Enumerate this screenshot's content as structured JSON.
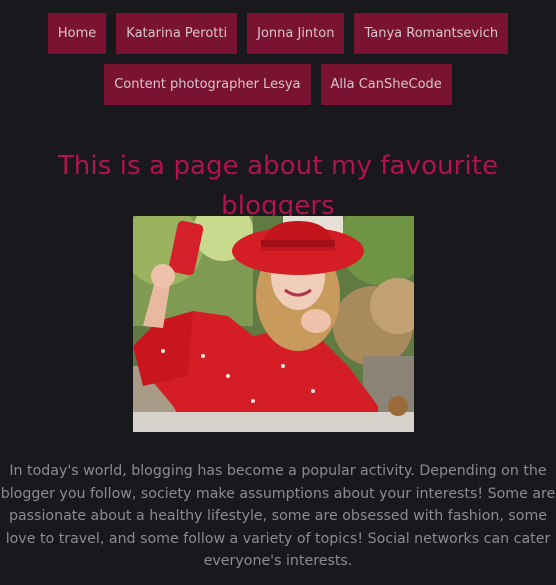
{
  "nav": {
    "items": [
      {
        "label": "Home"
      },
      {
        "label": "Katarina Perotti"
      },
      {
        "label": "Jonna Jinton"
      },
      {
        "label": "Tanya Romantsevich"
      },
      {
        "label": "Content photographer Lesya"
      },
      {
        "label": "Alla CanSheCode"
      }
    ]
  },
  "main": {
    "title": "This is a page about my favourite bloggers",
    "intro": "In today's world, blogging has become a popular activity. Depending on the blogger you follow, society make assumptions about your interests! Some are passionate about a healthy lifestyle, some are obsessed with fashion, some love to travel, and some follow a variety of topics! Social networks can cater everyone's interests."
  },
  "colors": {
    "background": "#19181c",
    "nav_button": "#7a1331",
    "title": "#b0144a",
    "body_text": "#8e8a92"
  }
}
